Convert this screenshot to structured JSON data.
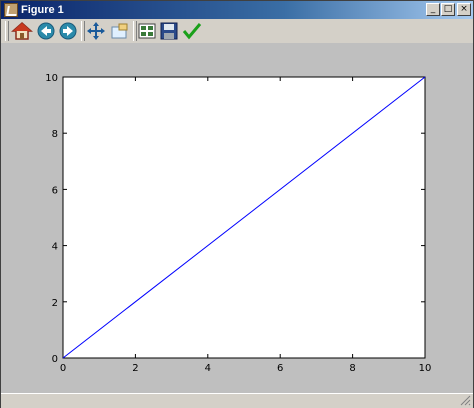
{
  "window": {
    "title": "Figure 1"
  },
  "window_buttons": {
    "minimize": "_",
    "maximize": "□",
    "close": "×"
  },
  "toolbar": {
    "buttons": [
      {
        "icon": "home-icon"
      },
      {
        "icon": "back-icon"
      },
      {
        "icon": "forward-icon"
      },
      {
        "icon": "pan-icon"
      },
      {
        "icon": "zoom-rect-icon"
      },
      {
        "icon": "subplots-icon"
      },
      {
        "icon": "save-icon"
      },
      {
        "icon": "check-icon"
      }
    ]
  },
  "chart_data": {
    "type": "line",
    "title": "",
    "xlabel": "",
    "ylabel": "",
    "xlim": [
      0,
      10
    ],
    "ylim": [
      0,
      10
    ],
    "xticks": [
      "0",
      "2",
      "4",
      "6",
      "8",
      "10"
    ],
    "yticks": [
      "0",
      "2",
      "4",
      "6",
      "8",
      "10"
    ],
    "grid": false,
    "series": [
      {
        "x": [
          0,
          10
        ],
        "y": [
          0,
          10
        ],
        "color": "#0000ff"
      }
    ]
  }
}
